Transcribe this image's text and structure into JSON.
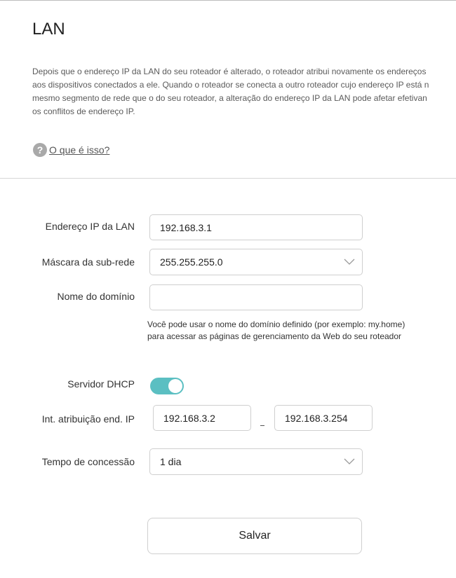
{
  "page": {
    "title": "LAN",
    "description": "Depois que o endereço IP da LAN do seu roteador é alterado, o roteador atribui novamente os endereços\naos dispositivos conectados a ele. Quando o roteador se conecta a outro roteador cujo endereço IP está n\nmesmo segmento de rede que o do seu roteador, a alteração do endereço IP da LAN pode afetar efetivan\nos conflitos de endereço IP.",
    "help_icon": "?",
    "help_link": "O que é isso?"
  },
  "form": {
    "lan_ip": {
      "label": "Endereço IP da LAN",
      "value": "192.168.3.1"
    },
    "subnet_mask": {
      "label": "Máscara da sub-rede",
      "value": "255.255.255.0"
    },
    "domain_name": {
      "label": "Nome do domínio",
      "value": "",
      "hint": "Você pode usar o nome do domínio definido (por exemplo: my.home) para acessar as páginas de gerenciamento da Web do seu roteador"
    },
    "dhcp_server": {
      "label": "Servidor DHCP",
      "enabled": true
    },
    "ip_range": {
      "label": "Int. atribuição end. IP",
      "start": "192.168.3.2",
      "end": "192.168.3.254"
    },
    "lease_time": {
      "label": "Tempo de concessão",
      "value": "1 dia"
    }
  },
  "actions": {
    "save_label": "Salvar"
  },
  "colors": {
    "toggle_on": "#5bbfc2",
    "border": "#cfcfcf"
  },
  "icons": {
    "help": "question-circle-icon",
    "dropdown": "chevron-down-icon"
  }
}
